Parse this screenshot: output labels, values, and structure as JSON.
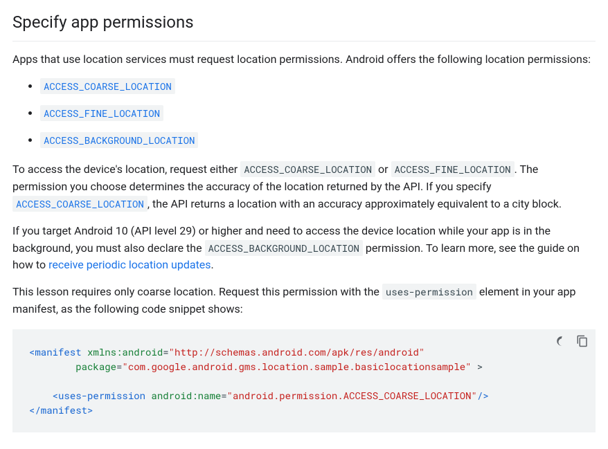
{
  "section": {
    "title": "Specify app permissions",
    "p1": "Apps that use location services must request location permissions. Android offers the following location permissions:",
    "perm_links": [
      "ACCESS_COARSE_LOCATION",
      "ACCESS_FINE_LOCATION",
      "ACCESS_BACKGROUND_LOCATION"
    ],
    "p2_parts": {
      "t0": "To access the device's location, request either ",
      "c0": "ACCESS_COARSE_LOCATION",
      "t1": " or ",
      "c1": "ACCESS_FINE_LOCATION",
      "t2": ". The permission you choose determines the accuracy of the location returned by the API. If you specify ",
      "c2": "ACCESS_COARSE_LOCATION",
      "t3": ", the API returns a location with an accuracy approximately equivalent to a city block."
    },
    "p3_parts": {
      "t0": "If you target Android 10 (API level 29) or higher and need to access the device location while your app is in the background, you must also declare the ",
      "c0": "ACCESS_BACKGROUND_LOCATION",
      "t1": " permission. To learn more, see the guide on how to ",
      "link": "receive periodic location updates",
      "t2": "."
    },
    "p4_parts": {
      "t0": "This lesson requires only coarse location. Request this permission with the ",
      "c0": "uses-permission",
      "t1": " element in your app manifest, as the following code snippet shows:"
    },
    "code": {
      "l1_tag_open": "<manifest",
      "l1_attr1": " xmlns:android",
      "l1_eq1": "=",
      "l1_str1": "\"http://schemas.android.com/apk/res/android\"",
      "l2_prefix": "        ",
      "l2_attr": "package",
      "l2_eq": "=",
      "l2_str": "\"com.google.android.gms.location.sample.basiclocationsample\"",
      "l2_close": " >",
      "l3_blank": "",
      "l4_prefix": "    ",
      "l4_tag": "<uses-permission",
      "l4_attr": " android:name",
      "l4_eq": "=",
      "l4_str": "\"android.permission.ACCESS_COARSE_LOCATION\"",
      "l4_close": "/>",
      "l5_tag": "</manifest>"
    }
  }
}
